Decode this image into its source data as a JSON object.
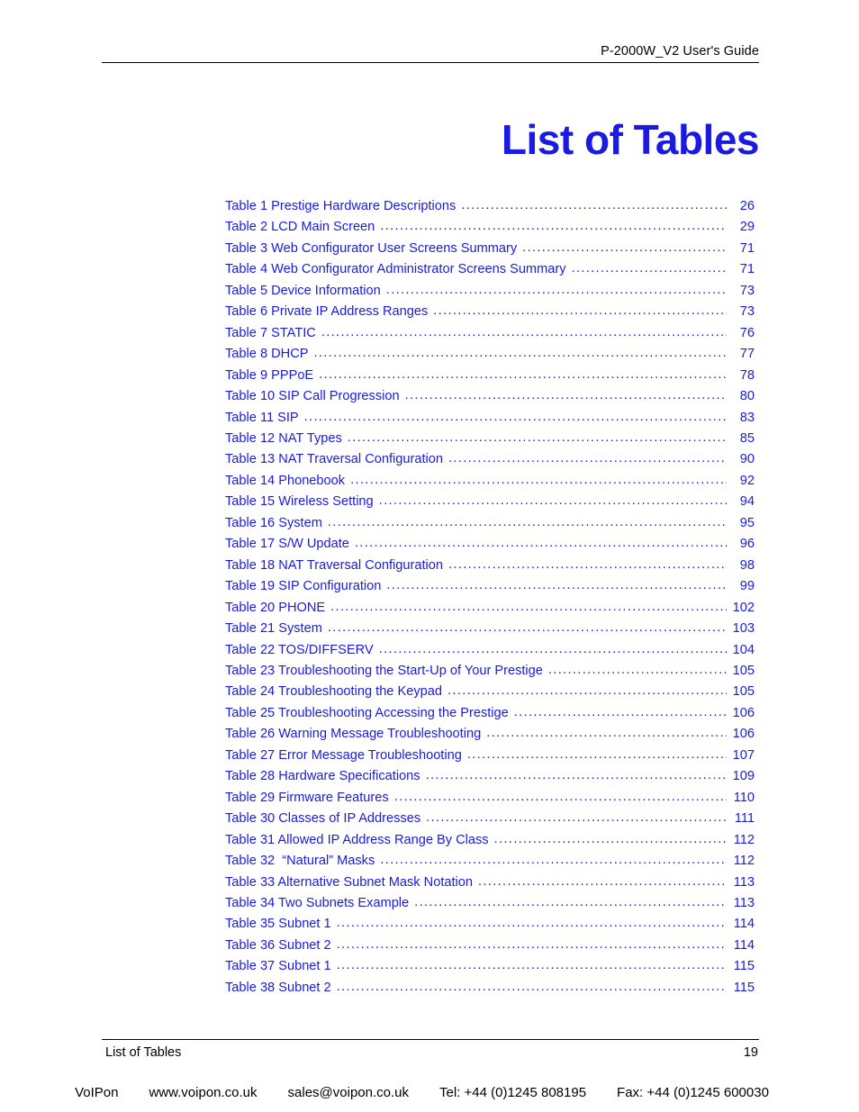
{
  "header": {
    "running_title": "P-2000W_V2 User's Guide"
  },
  "title": "List of Tables",
  "list_of_tables": {
    "leader": "...........................................................................................................................................................",
    "entries": [
      {
        "label": "Table 1 Prestige Hardware Descriptions",
        "page": "26"
      },
      {
        "label": "Table 2 LCD Main Screen",
        "page": "29"
      },
      {
        "label": "Table 3 Web Configurator User Screens Summary",
        "page": "71"
      },
      {
        "label": "Table 4 Web Configurator Administrator Screens Summary",
        "page": "71"
      },
      {
        "label": "Table 5 Device Information",
        "page": "73"
      },
      {
        "label": "Table 6 Private IP Address Ranges",
        "page": "73"
      },
      {
        "label": "Table 7 STATIC",
        "page": "76"
      },
      {
        "label": "Table 8 DHCP",
        "page": "77"
      },
      {
        "label": "Table 9 PPPoE",
        "page": "78"
      },
      {
        "label": "Table 10 SIP Call Progression",
        "page": "80"
      },
      {
        "label": "Table 11 SIP",
        "page": "83"
      },
      {
        "label": "Table 12 NAT Types",
        "page": "85"
      },
      {
        "label": "Table 13 NAT Traversal Configuration",
        "page": "90"
      },
      {
        "label": "Table 14 Phonebook",
        "page": "92"
      },
      {
        "label": "Table 15 Wireless Setting",
        "page": "94"
      },
      {
        "label": "Table 16 System",
        "page": "95"
      },
      {
        "label": "Table 17 S/W Update",
        "page": "96"
      },
      {
        "label": "Table 18 NAT Traversal Configuration",
        "page": "98"
      },
      {
        "label": "Table 19 SIP Configuration",
        "page": "99"
      },
      {
        "label": "Table 20 PHONE",
        "page": "102"
      },
      {
        "label": "Table 21 System",
        "page": "103"
      },
      {
        "label": "Table 22 TOS/DIFFSERV",
        "page": "104"
      },
      {
        "label": "Table 23 Troubleshooting the Start-Up of Your Prestige",
        "page": "105"
      },
      {
        "label": "Table 24 Troubleshooting the Keypad",
        "page": "105"
      },
      {
        "label": "Table 25 Troubleshooting Accessing the Prestige",
        "page": "106"
      },
      {
        "label": "Table 26 Warning Message Troubleshooting",
        "page": "106"
      },
      {
        "label": "Table 27 Error Message Troubleshooting",
        "page": "107"
      },
      {
        "label": "Table 28 Hardware Specifications",
        "page": "109"
      },
      {
        "label": "Table 29 Firmware Features",
        "page": "110"
      },
      {
        "label": "Table 30 Classes of IP Addresses",
        "page": "111"
      },
      {
        "label": "Table 31 Allowed IP Address Range By Class",
        "page": "112"
      },
      {
        "label": "Table 32  “Natural” Masks",
        "page": "112"
      },
      {
        "label": "Table 33 Alternative Subnet Mask Notation",
        "page": "113"
      },
      {
        "label": "Table 34 Two Subnets Example",
        "page": "113"
      },
      {
        "label": "Table 35 Subnet 1",
        "page": "114"
      },
      {
        "label": "Table 36 Subnet 2",
        "page": "114"
      },
      {
        "label": "Table 37 Subnet 1",
        "page": "115"
      },
      {
        "label": "Table 38 Subnet 2",
        "page": "115"
      }
    ]
  },
  "footer": {
    "section": "List of Tables",
    "page_number": "19"
  },
  "vendor": {
    "name": "VoIPon",
    "website": "www.voipon.co.uk",
    "email": "sales@voipon.co.uk",
    "tel": "Tel: +44 (0)1245 808195",
    "fax": "Fax: +44 (0)1245 600030"
  },
  "colors": {
    "link_blue": "#1a1ae0",
    "text_black": "#000000"
  }
}
